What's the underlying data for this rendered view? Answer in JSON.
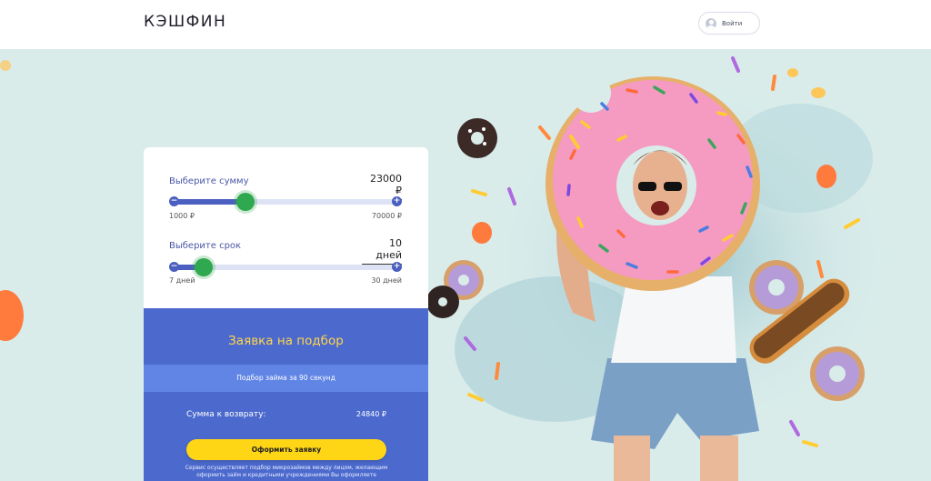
{
  "header": {
    "logo": "КЭШФИН",
    "login_label": "Войти"
  },
  "calculator": {
    "amount": {
      "label": "Выберите сумму",
      "value": "23000 ₽",
      "min_label": "1000 ₽",
      "max_label": "70000 ₽",
      "slider_value": 23000,
      "slider_min": 1000,
      "slider_max": 70000
    },
    "term": {
      "label": "Выберите срок",
      "value": "10 дней",
      "min_label": "7 дней",
      "max_label": "30 дней",
      "slider_value": 10,
      "slider_min": 7,
      "slider_max": 30
    }
  },
  "application": {
    "title": "Заявка на подбор",
    "band_text": "Подбор займа за 90 секунд",
    "return_label": "Сумма к возврату:",
    "return_value": "24840 ₽",
    "submit_label": "Оформить заявку",
    "disclaimer": "Сервис осуществляет подбор микрозаймов между лицом, желающим оформить займ и кредитными учреждениями Вы оформляете"
  },
  "colors": {
    "accent_blue": "#4c6acd",
    "band_blue": "#6085e5",
    "knob_green": "#2fa84f",
    "button_yellow": "#ffd615",
    "title_yellow": "#ffd54a",
    "donut_pink": "#f59ac0"
  },
  "icons": {
    "login": "user-icon",
    "increase": "plus-icon",
    "decrease": "minus-icon"
  }
}
